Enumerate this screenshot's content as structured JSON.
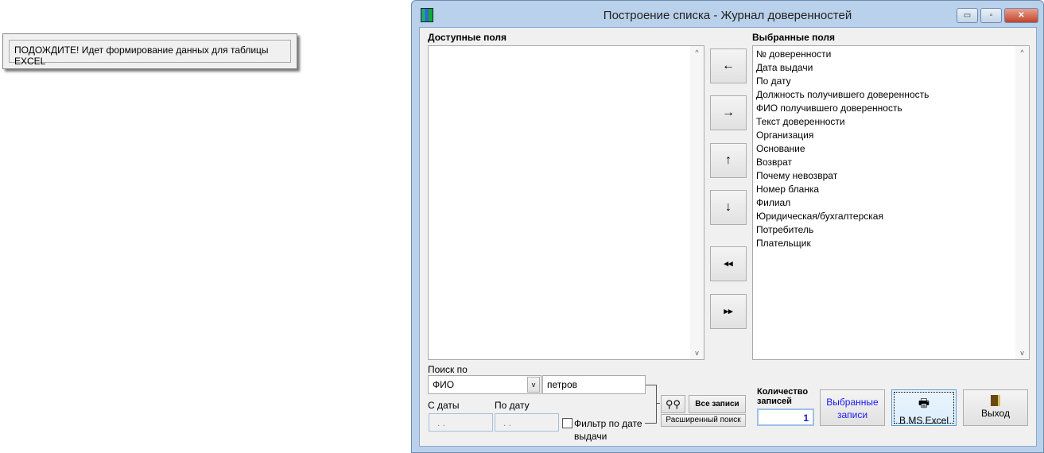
{
  "wait_message": "ПОДОЖДИТЕ! Идет формирование данных для таблицы EXCEL",
  "window": {
    "title": "Построение списка - Журнал доверенностей",
    "minimize": "▭",
    "maximize": "▫",
    "close": "✕"
  },
  "available": {
    "label": "Доступные поля",
    "items": []
  },
  "selected": {
    "label": "Выбранные поля",
    "items": [
      "№ доверенности",
      "Дата выдачи",
      "По дату",
      "Должность получившего доверенность",
      "ФИО получившего доверенность",
      "Текст доверенности",
      "Организация",
      "Основание",
      "Возврат",
      "Почему невозврат",
      "Номер бланка",
      "Филиал",
      "Юридическая/бухгалтерская",
      "Потребитель",
      "Плательщик"
    ]
  },
  "move_buttons": {
    "left": "←",
    "right": "→",
    "up": "↑",
    "down": "↓",
    "all_left": "◂◂",
    "all_right": "▸▸"
  },
  "search": {
    "label": "Поиск по",
    "field": "ФИО",
    "value": "петров",
    "from_label": "С даты",
    "to_label": "По дату",
    "from_value": " . .",
    "to_value": " . .",
    "filter_label": "Фильтр по дате выдачи",
    "filter_checked": false,
    "all_records": "Все записи",
    "advanced": "Расширенный поиск"
  },
  "count": {
    "label": "Количество записей",
    "value": "1"
  },
  "buttons": {
    "selected_records": "Выбранные записи",
    "excel": "В MS Excel",
    "exit": "Выход"
  }
}
